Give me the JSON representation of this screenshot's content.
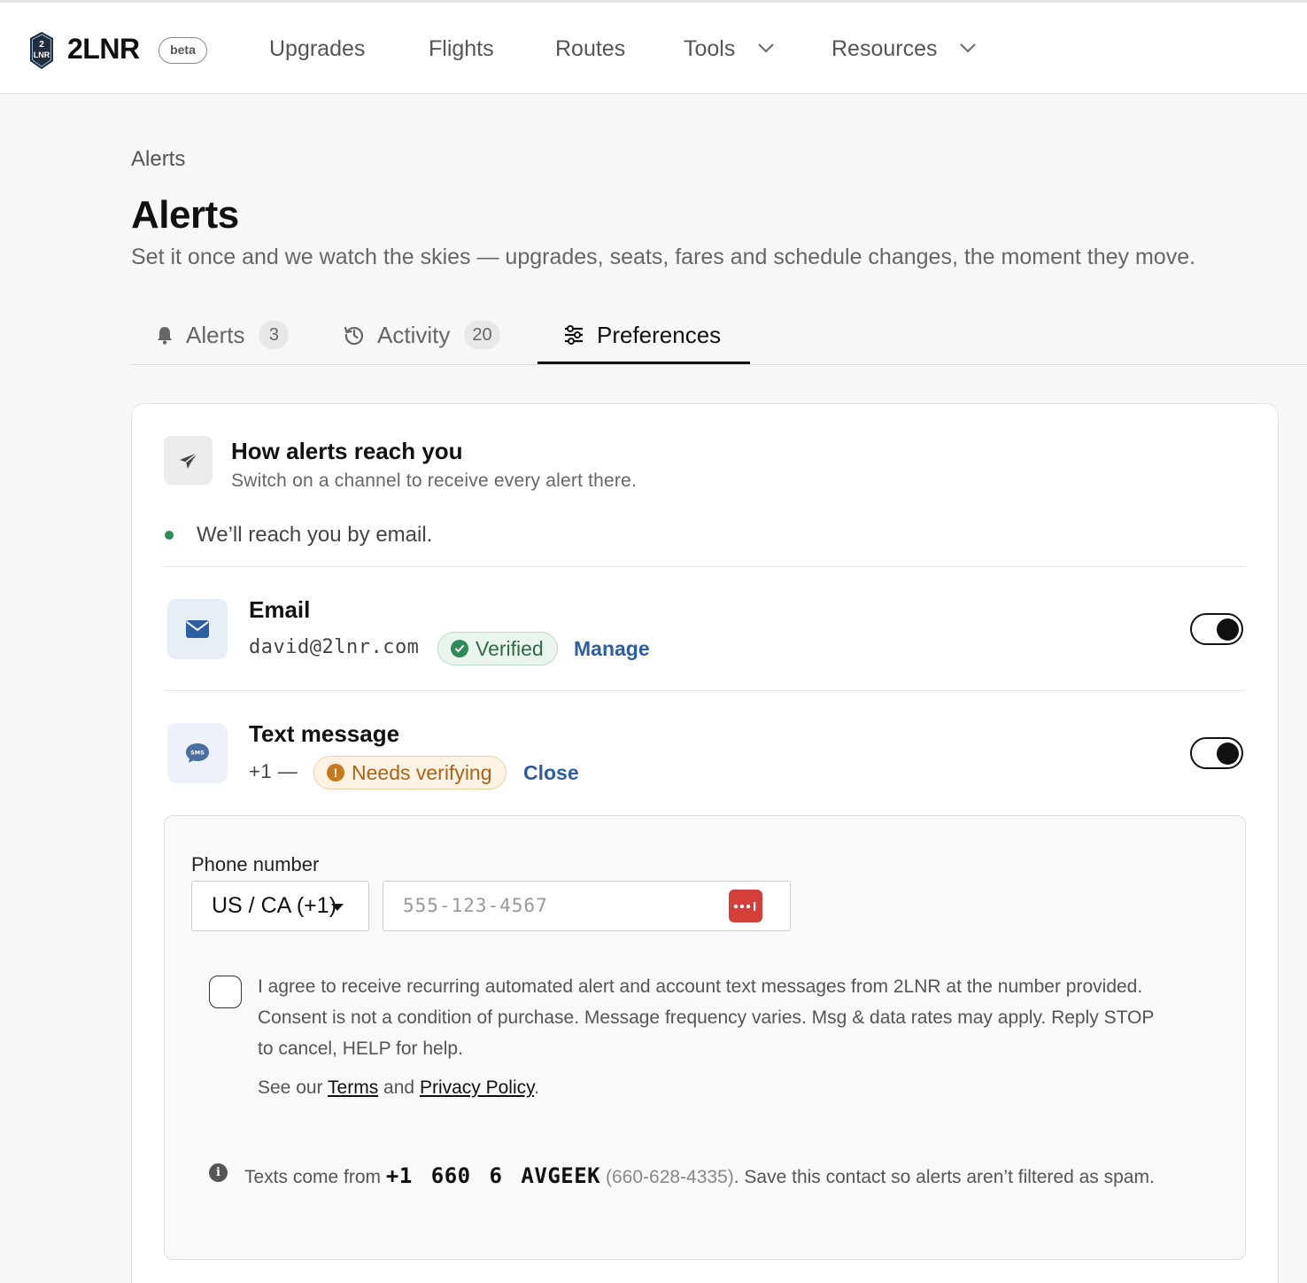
{
  "brand": {
    "name": "2LNR",
    "badge": "beta",
    "logo_text": "2 LNR"
  },
  "nav": {
    "items": [
      {
        "label": "Upgrades"
      },
      {
        "label": "Flights"
      },
      {
        "label": "Routes"
      },
      {
        "label": "Tools",
        "dropdown": true
      },
      {
        "label": "Resources",
        "dropdown": true
      }
    ]
  },
  "page": {
    "breadcrumb": "Alerts",
    "title": "Alerts",
    "subtitle": "Set it once and we watch the skies — upgrades, seats, fares and schedule changes, the moment they move."
  },
  "tabs": [
    {
      "label": "Alerts",
      "count": "3",
      "icon": "bell-icon",
      "active": false
    },
    {
      "label": "Activity",
      "count": "20",
      "icon": "history-icon",
      "active": false
    },
    {
      "label": "Preferences",
      "icon": "sliders-icon",
      "active": true
    }
  ],
  "delivery": {
    "title": "How alerts reach you",
    "description": "Switch on a channel to receive every alert there.",
    "status": "We’ll reach you by email.",
    "status_color": "#2e8b57",
    "channels": {
      "email": {
        "title": "Email",
        "value": "david@2lnr.com",
        "badge": "Verified",
        "action": "Manage",
        "enabled": true,
        "icon": "envelope-icon"
      },
      "sms": {
        "title": "Text message",
        "value": "+1 —",
        "badge": "Needs verifying",
        "action": "Close",
        "enabled": true,
        "icon": "sms-bubble-icon"
      }
    },
    "phone_form": {
      "label": "Phone number",
      "country": "US / CA (+1)",
      "placeholder": "555-123-4567",
      "consent_text": "I agree to receive recurring automated alert and account text messages from 2LNR at the number provided. Consent is not a condition of purchase. Message frequency varies. Msg & data rates may apply. Reply STOP to cancel, HELP for help.",
      "terms_prefix": "See our",
      "terms_label": "Terms",
      "terms_and": "and",
      "privacy_label": "Privacy Policy",
      "terms_suffix": ".",
      "info_prefix": "Texts come from",
      "vanity_number": "+1 660 6 AVGEEK",
      "digits_number": "(660-628-4335)",
      "info_suffix": ". Save this contact so alerts aren’t filtered as spam."
    }
  },
  "colors": {
    "accent_link": "#2d5fa0",
    "verified": "#2f6b45",
    "warning": "#a96417",
    "password_manager": "#d43f3a"
  }
}
